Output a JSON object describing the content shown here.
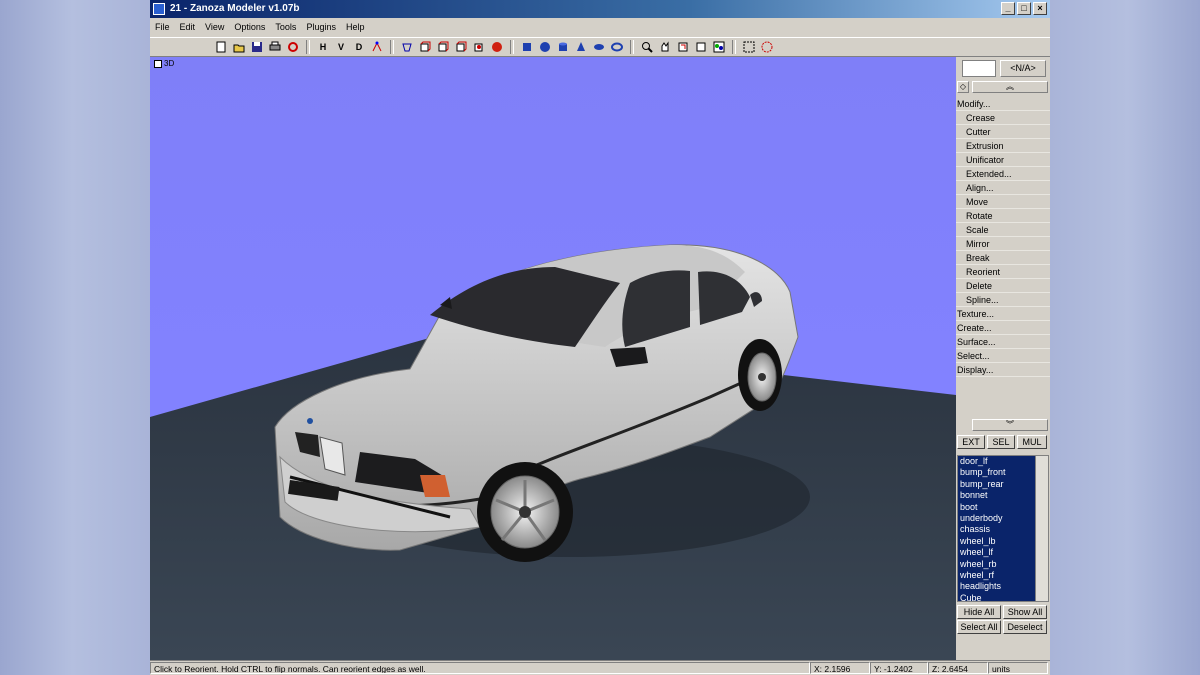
{
  "window": {
    "title": "21 - Zanoza Modeler v1.07b"
  },
  "menu": [
    "File",
    "Edit",
    "View",
    "Options",
    "Tools",
    "Plugins",
    "Help"
  ],
  "toolbar": {
    "view_h": "H",
    "view_v": "V",
    "view_d": "D",
    "icons": [
      "new-icon",
      "open-icon",
      "save-icon",
      "print-icon",
      "undo-icon",
      "view-h",
      "view-v",
      "view-d",
      "select-vertex-icon",
      "select-edge-icon",
      "cube-front-icon",
      "cube-side-icon",
      "cube-top-icon",
      "cube-iso-icon",
      "sphere-red-icon",
      "cube-blue-icon",
      "sphere-blue-icon",
      "cylinder-blue-icon",
      "cone-blue-icon",
      "torus-blue-icon",
      "ring-blue-icon",
      "zoom-icon",
      "pan-icon",
      "rotate-view-icon",
      "frame-icon",
      "scene-icon",
      "select-rect-icon",
      "select-circle-icon"
    ]
  },
  "viewport": {
    "label": "3D"
  },
  "panel": {
    "na_label": "<N/A>",
    "modify_items": [
      "Modify...",
      "Crease",
      "Cutter",
      "Extrusion",
      "Unificator",
      "Extended...",
      "Align...",
      "Move",
      "Rotate",
      "Scale",
      "Mirror",
      "Break",
      "Reorient",
      "Delete",
      "Spline...",
      "Texture...",
      "Create...",
      "Surface...",
      "Select...",
      "Display..."
    ],
    "sub_items": [
      "Crease",
      "Cutter",
      "Extrusion",
      "Unificator",
      "Extended...",
      "Align...",
      "Move",
      "Rotate",
      "Scale",
      "Mirror",
      "Break",
      "Reorient",
      "Delete",
      "Spline..."
    ],
    "mode_buttons": [
      "EXT",
      "SEL",
      "MUL"
    ],
    "objects": [
      "door_lf",
      "bump_front",
      "bump_rear",
      "bonnet",
      "boot",
      "underbody",
      "chassis",
      "wheel_lb",
      "wheel_lf",
      "wheel_rb",
      "wheel_rf",
      "headlights",
      "Cube"
    ],
    "hide_all": "Hide All",
    "show_all": "Show All",
    "select_all": "Select All",
    "deselect": "Deselect"
  },
  "status": {
    "message": "Click to Reorient. Hold CTRL to flip normals. Can reorient edges as well.",
    "x": "X: 2.1596",
    "y": "Y: -1.2402",
    "z": "Z: 2.6454",
    "units": "units"
  },
  "colors": {
    "viewport_bg": "#8282ff",
    "floor": "#2e3944",
    "car_body": "#d8d8d8",
    "title_start": "#0a246a"
  }
}
